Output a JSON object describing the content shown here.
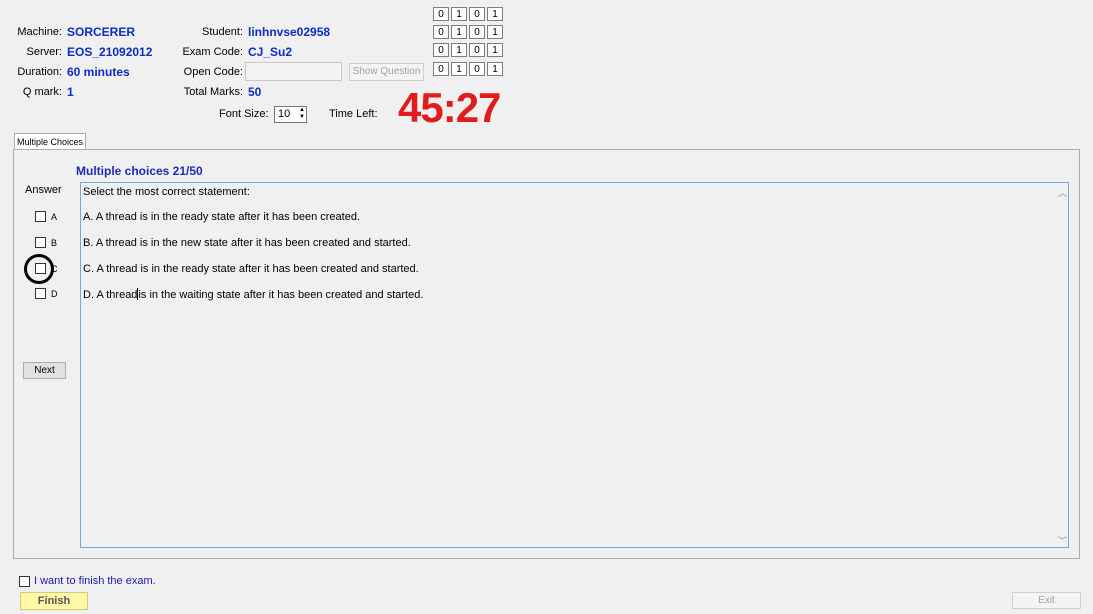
{
  "header": {
    "machine_label": "Machine:",
    "machine_value": "SORCERER",
    "server_label": "Server:",
    "server_value": "EOS_21092012",
    "duration_label": "Duration:",
    "duration_value": "60 minutes",
    "qmark_label": "Q mark:",
    "qmark_value": "1",
    "student_label": "Student:",
    "student_value": "linhnvse02958",
    "examcode_label": "Exam Code:",
    "examcode_value": "CJ_Su2",
    "opencode_label": "Open Code:",
    "opencode_value": "",
    "show_question_label": "Show Question",
    "totalmarks_label": "Total Marks:",
    "totalmarks_value": "50",
    "fontsize_label": "Font Size:",
    "fontsize_value": "10",
    "timeleft_label": "Time Left:",
    "timer_value": "45:27"
  },
  "bit_grid": [
    [
      "0",
      "1",
      "0",
      "1"
    ],
    [
      "0",
      "1",
      "0",
      "1"
    ],
    [
      "0",
      "1",
      "0",
      "1"
    ],
    [
      "0",
      "1",
      "0",
      "1"
    ]
  ],
  "tab": {
    "label": "Multiple Choices"
  },
  "question": {
    "title": "Multiple choices 21/50",
    "answer_label": "Answer",
    "prompt": "Select the most correct statement:",
    "options": [
      {
        "key": "A",
        "text": "A.  A thread is in the ready state after it has been created."
      },
      {
        "key": "B",
        "text": "B.  A thread is in the new state after it has been created and started."
      },
      {
        "key": "C",
        "text": "C.  A thread is in the ready state after it has been created and started."
      },
      {
        "key": "D",
        "text_before_caret": "D.  A thread",
        "text_after_caret": "is in the waiting state after it has been created and started."
      }
    ],
    "next_label": "Next"
  },
  "footer": {
    "finish_check_label": "I want to finish the exam.",
    "finish_label": "Finish",
    "exit_label": "Exit"
  }
}
